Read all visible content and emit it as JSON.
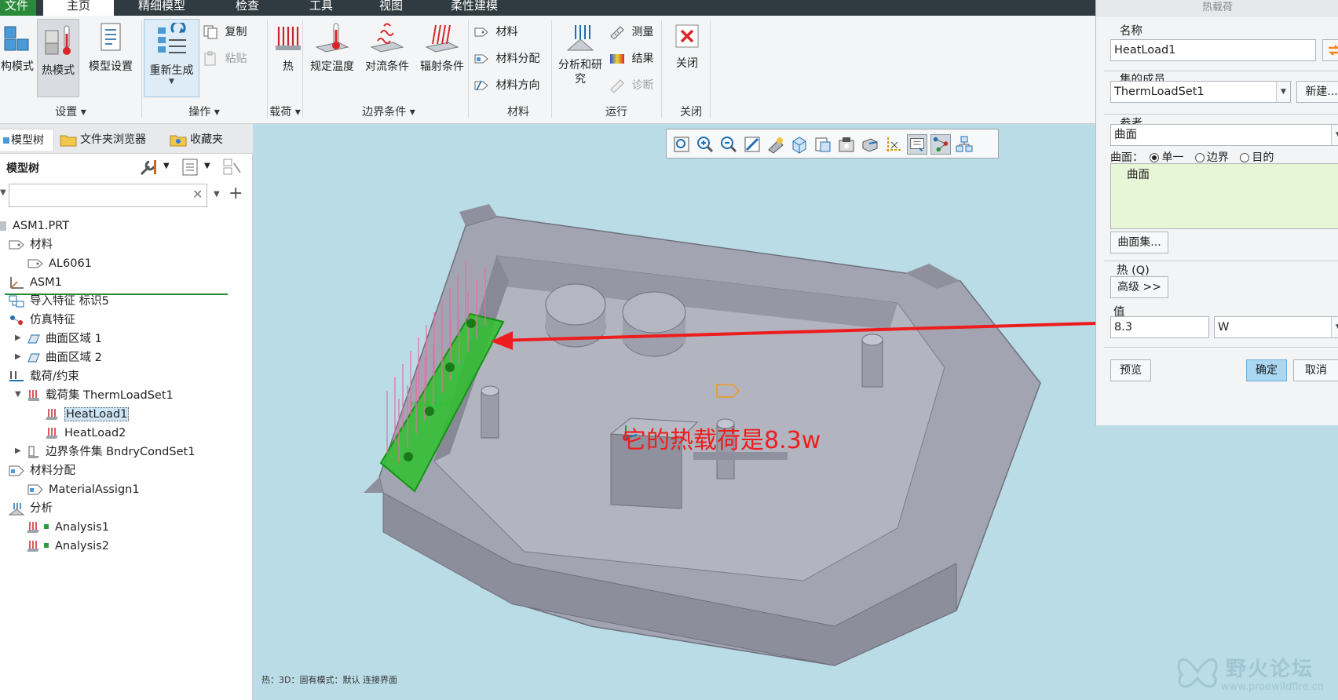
{
  "tabs": [
    "文件",
    "主页",
    "精细模型",
    "检查",
    "工具",
    "视图",
    "柔性建模"
  ],
  "ribbon": {
    "big_buttons": {
      "struct_mode": "构模式",
      "thermal_mode": "热模式",
      "model_setup": "模型设置",
      "regenerate": "重新生成",
      "heat": "热",
      "prescribed_temp": "规定温度",
      "convection": "对流条件",
      "radiation": "辐射条件",
      "analyses": "分析和研究",
      "close": "关闭"
    },
    "small_buttons": {
      "copy": "复制",
      "paste": "粘贴",
      "materials": "材料",
      "material_assign": "材料分配",
      "material_orient": "材料方向",
      "measure": "测量",
      "results": "结果",
      "diagnose": "诊断"
    },
    "groups": {
      "setup": "设置",
      "operations": "操作",
      "loads": "载荷",
      "boundary": "边界条件",
      "materials": "材料",
      "run": "运行",
      "close": "关闭"
    }
  },
  "left_panel": {
    "tabs": [
      "模型树",
      "文件夹浏览器",
      "收藏夹"
    ],
    "header": "模型树",
    "search_placeholder": "",
    "tree": {
      "root": "ASM1.PRT",
      "materials": "材料",
      "al6061": "AL6061",
      "asm1": "ASM1",
      "import": "导入特征 标识5",
      "sim": "仿真特征",
      "surf1": "曲面区域 1",
      "surf2": "曲面区域 2",
      "loads": "载荷/约束",
      "loadset": "载荷集 ThermLoadSet1",
      "heatload1": "HeatLoad1",
      "heatload2": "HeatLoad2",
      "bcset": "边界条件集 BndryCondSet1",
      "matassign": "材料分配",
      "matassign1": "MaterialAssign1",
      "analysis": "分析",
      "analysis1": "Analysis1",
      "analysis2": "Analysis2"
    }
  },
  "viewport": {
    "annotation": "它的热载荷是8.3w",
    "status": "热：3D：固有模式：默认 连接界面",
    "model_label": "HeatLoad1"
  },
  "dialog": {
    "title": "热载荷",
    "name_label": "名称",
    "name_value": "HeatLoad1",
    "member_label": "集的成员",
    "member_value": "ThermLoadSet1",
    "new_button": "新建...",
    "ref_label": "参考",
    "ref_type": "曲面",
    "surface_label": "曲面：",
    "radio_single": "单一",
    "radio_boundary": "边界",
    "radio_target": "目的",
    "ref_item": "曲面",
    "surface_set_button": "曲面集...",
    "heat_label": "热 (Q)",
    "advanced_button": "高级 >>",
    "value_label": "值",
    "value": "8.3",
    "unit": "W",
    "preview_button": "预览",
    "ok_button": "确定",
    "cancel_button": "取消"
  },
  "watermark": {
    "title": "野火论坛",
    "url": "www.proewildfire.cn"
  },
  "colors": {
    "accent": "#2a8a3a",
    "viewport_bg": "#b9dce6",
    "annotation": "#ee1d1d",
    "ok_button": "#aad7f2"
  }
}
